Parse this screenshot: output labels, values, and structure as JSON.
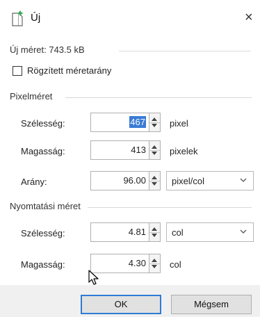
{
  "window": {
    "title": "Új",
    "close_symbol": "×"
  },
  "new_size": {
    "label": "Új méret: 743.5 kB"
  },
  "aspect_lock": {
    "label": "Rögzített méretarány",
    "checked": false
  },
  "pixel_section": {
    "title": "Pixelméret",
    "width": {
      "label": "Szélesség:",
      "value": "467",
      "unit": "pixel"
    },
    "height": {
      "label": "Magasság:",
      "value": "413",
      "unit": "pixelek"
    },
    "ratio": {
      "label": "Arány:",
      "value": "96.00",
      "unit_selected": "pixel/col"
    }
  },
  "print_section": {
    "title": "Nyomtatási méret",
    "width": {
      "label": "Szélesség:",
      "value": "4.81",
      "unit_selected": "col"
    },
    "height": {
      "label": "Magasság:",
      "value": "4.30",
      "unit": "col"
    }
  },
  "buttons": {
    "ok": "OK",
    "cancel": "Mégsem"
  },
  "icons": [
    "new-document-icon",
    "close-icon",
    "spinner-up-icon",
    "spinner-down-icon",
    "chevron-down-icon",
    "mouse-cursor-icon"
  ],
  "colors": {
    "accent": "#2e7bd6",
    "selection": "#3a7bd5",
    "footer": "#f0f0f0"
  }
}
